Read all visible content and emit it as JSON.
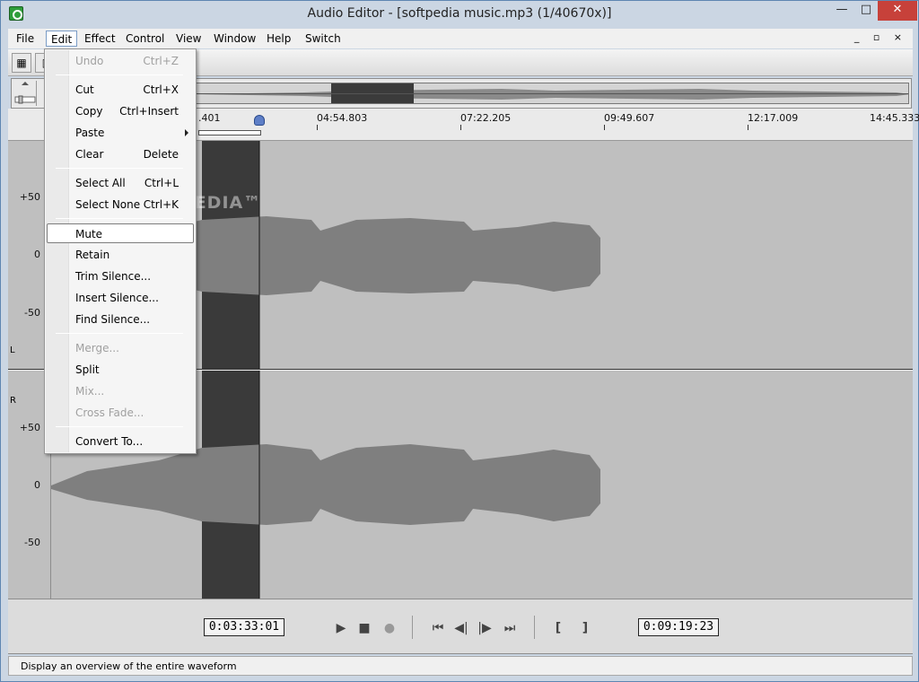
{
  "window": {
    "title": "Audio Editor - [softpedia music.mp3 (1/40670x)]",
    "minimize": "—",
    "maximize": "□",
    "close": "✕",
    "mdi_controls": "_ ▫ ×"
  },
  "menubar": {
    "items": [
      "File",
      "Edit",
      "Effect",
      "Control",
      "View",
      "Window",
      "Help",
      "Switch"
    ]
  },
  "edit_menu": {
    "items": [
      {
        "label": "Undo",
        "shortcut": "Ctrl+Z",
        "enabled": false
      },
      {
        "label": "Cut",
        "shortcut": "Ctrl+X",
        "enabled": true
      },
      {
        "label": "Copy",
        "shortcut": "Ctrl+Insert",
        "enabled": true
      },
      {
        "label": "Paste",
        "shortcut": "",
        "enabled": true,
        "submenu": true
      },
      {
        "label": "Clear",
        "shortcut": "Delete",
        "enabled": true
      },
      {
        "label": "Select All",
        "shortcut": "Ctrl+L",
        "enabled": true
      },
      {
        "label": "Select None",
        "shortcut": "Ctrl+K",
        "enabled": true
      },
      {
        "label": "Mute",
        "shortcut": "",
        "enabled": true,
        "highlighted": true
      },
      {
        "label": "Retain",
        "shortcut": "",
        "enabled": true
      },
      {
        "label": "Trim Silence...",
        "shortcut": "",
        "enabled": true
      },
      {
        "label": "Insert Silence...",
        "shortcut": "",
        "enabled": true
      },
      {
        "label": "Find Silence...",
        "shortcut": "",
        "enabled": true
      },
      {
        "label": "Merge...",
        "shortcut": "",
        "enabled": false
      },
      {
        "label": "Split",
        "shortcut": "",
        "enabled": true
      },
      {
        "label": "Mix...",
        "shortcut": "",
        "enabled": false
      },
      {
        "label": "Cross Fade...",
        "shortcut": "",
        "enabled": false
      },
      {
        "label": "Convert To...",
        "shortcut": "",
        "enabled": true
      }
    ]
  },
  "timeline": {
    "ticks": [
      ".401",
      "04:54.803",
      "07:22.205",
      "09:49.607",
      "12:17.009",
      "14:45.333"
    ]
  },
  "tracks": {
    "left_channel": "L",
    "right_channel": "R",
    "y_labels_top": [
      "+50",
      "0",
      "-50"
    ],
    "y_labels_bottom": [
      "+50",
      "0",
      "-50"
    ]
  },
  "watermark": "SOFTPEDIA™",
  "transport": {
    "start_time": "0:03:33:01",
    "end_time": "0:09:19:23",
    "buttons": {
      "play": "▶",
      "stop": "■",
      "record": "●",
      "go_start": "⏮",
      "step_back": "◀|",
      "step_forward": "|▶",
      "go_end": "⏭",
      "mark_in": "[",
      "mark_out": "]"
    }
  },
  "status": {
    "text": "Display an overview of the entire waveform"
  },
  "colors": {
    "selection": "#3a3a3a",
    "waveform": "#7f7f7f",
    "track_bg": "#bfbfbf",
    "close_btn": "#c7413a"
  }
}
